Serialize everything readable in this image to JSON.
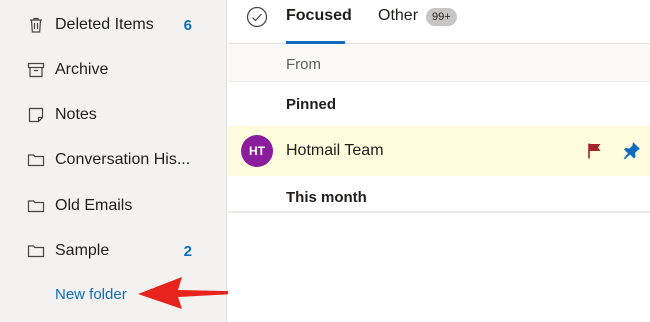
{
  "sidebar": {
    "folders": [
      {
        "label": "Deleted Items",
        "count": "6",
        "icon": "trash-icon"
      },
      {
        "label": "Archive",
        "count": "",
        "icon": "archive-icon"
      },
      {
        "label": "Notes",
        "count": "",
        "icon": "note-icon"
      },
      {
        "label": "Conversation His...",
        "count": "",
        "icon": "folder-icon"
      },
      {
        "label": "Old Emails",
        "count": "",
        "icon": "folder-icon"
      },
      {
        "label": "Sample",
        "count": "2",
        "icon": "folder-icon"
      }
    ],
    "new_folder_label": "New folder"
  },
  "tabs": {
    "focused_label": "Focused",
    "other_label": "Other",
    "other_badge": "99+"
  },
  "list": {
    "from_label": "From",
    "pinned_label": "Pinned",
    "this_month_label": "This month",
    "messages": [
      {
        "avatar_initials": "HT",
        "sender": "Hotmail Team",
        "flagged": true,
        "pinned": true
      }
    ]
  },
  "colors": {
    "accent": "#0f6cbd",
    "avatar": "#8b1d9c",
    "pinned_row": "#fffbdd",
    "flag": "#a4262c",
    "arrow": "#e8221c"
  }
}
